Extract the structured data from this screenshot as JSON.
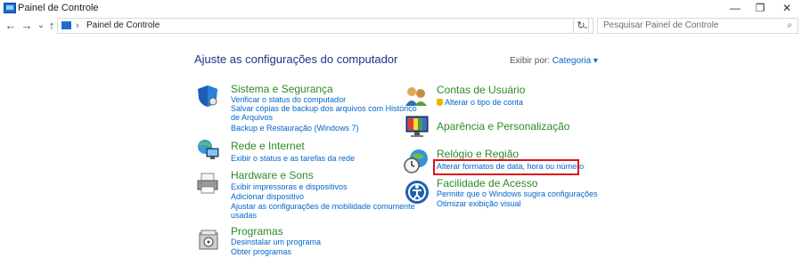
{
  "window": {
    "title": "Painel de Controle",
    "minimize": "—",
    "restore": "❐",
    "close": "✕"
  },
  "nav": {
    "back": "←",
    "forward": "→",
    "history": "⌄",
    "up": "↑"
  },
  "address": {
    "separator": "›",
    "crumb": "Painel de Controle",
    "dropdown": "⌄",
    "refresh": "↻"
  },
  "search": {
    "placeholder": "Pesquisar Painel de Controle",
    "icon": "⌕"
  },
  "page": {
    "heading": "Ajuste as configurações do computador",
    "view_by_label": "Exibir por:",
    "view_by_value": "Categoria ▾"
  },
  "left": [
    {
      "title": "Sistema e Segurança",
      "links": [
        "Verificar o status do computador",
        "Salvar cópias de backup dos arquivos com Histórico",
        "de Arquivos",
        "Backup e Restauração (Windows 7)"
      ]
    },
    {
      "title": "Rede e Internet",
      "links": [
        "Exibir o status e as tarefas da rede"
      ]
    },
    {
      "title": "Hardware e Sons",
      "links": [
        "Exibir impressoras e dispositivos",
        "Adicionar dispositivo",
        "Ajustar as configurações de mobilidade comumente",
        "usadas"
      ]
    },
    {
      "title": "Programas",
      "links": [
        "Desinstalar um programa",
        "Obter programas"
      ]
    }
  ],
  "right": [
    {
      "title": "Contas de Usuário",
      "links": [
        "Alterar o tipo de conta"
      ]
    },
    {
      "title": "Aparência e Personalização",
      "links": []
    },
    {
      "title": "Relógio e Região",
      "links": [
        "Alterar formatos de data, hora ou número"
      ]
    },
    {
      "title": "Facilidade de Acesso",
      "links": [
        "Permitir que o Windows sugira configurações",
        "Otimizar exibição visual"
      ]
    }
  ]
}
